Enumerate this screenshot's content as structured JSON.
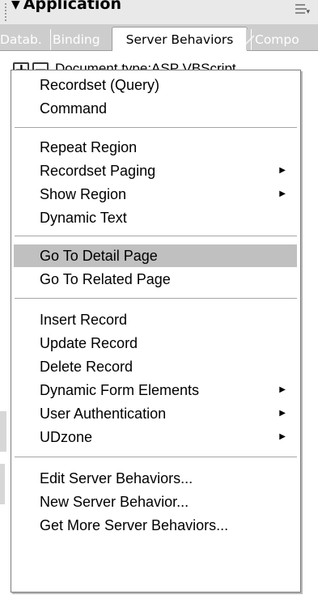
{
  "panel": {
    "title": "Application",
    "arrow": "▼"
  },
  "tabs": [
    {
      "label": "Datab."
    },
    {
      "label": "Binding"
    },
    {
      "label": "Server Behaviors"
    },
    {
      "label": "Compo"
    }
  ],
  "toolbar": {
    "add_symbol": "+",
    "remove_symbol": "−",
    "document_type": "Document type:ASP VBScript"
  },
  "menu": {
    "items": [
      {
        "label": "Recordset (Query)"
      },
      {
        "label": "Command"
      },
      {
        "label": "Repeat Region"
      },
      {
        "label": "Recordset Paging",
        "submenu": "▶"
      },
      {
        "label": "Show Region",
        "submenu": "▶"
      },
      {
        "label": "Dynamic Text"
      },
      {
        "label": "Go To Detail Page",
        "highlighted": true
      },
      {
        "label": "Go To Related Page"
      },
      {
        "label": "Insert Record"
      },
      {
        "label": "Update Record"
      },
      {
        "label": "Delete Record"
      },
      {
        "label": "Dynamic Form Elements",
        "submenu": "▶"
      },
      {
        "label": "User Authentication",
        "submenu": "▶"
      },
      {
        "label": "UDzone",
        "submenu": "▶"
      },
      {
        "label": "Edit Server Behaviors..."
      },
      {
        "label": "New Server Behavior..."
      },
      {
        "label": "Get More Server Behaviors..."
      }
    ]
  },
  "colors": {
    "highlight": "#c0c0c0",
    "tab_bar": "#cdcdcd"
  }
}
